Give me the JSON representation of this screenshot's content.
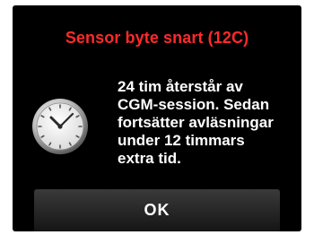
{
  "dialog": {
    "title": "Sensor byte snart (12C)",
    "message": "24 tim återstår av\nCGM-session. Sedan\nfortsätter avläsningar\nunder 12 timmars\nextra tid.",
    "icon": "clock-icon",
    "ok_label": "OK"
  },
  "colors": {
    "title": "#ff2a2a",
    "background": "#000000",
    "text": "#ffffff"
  }
}
